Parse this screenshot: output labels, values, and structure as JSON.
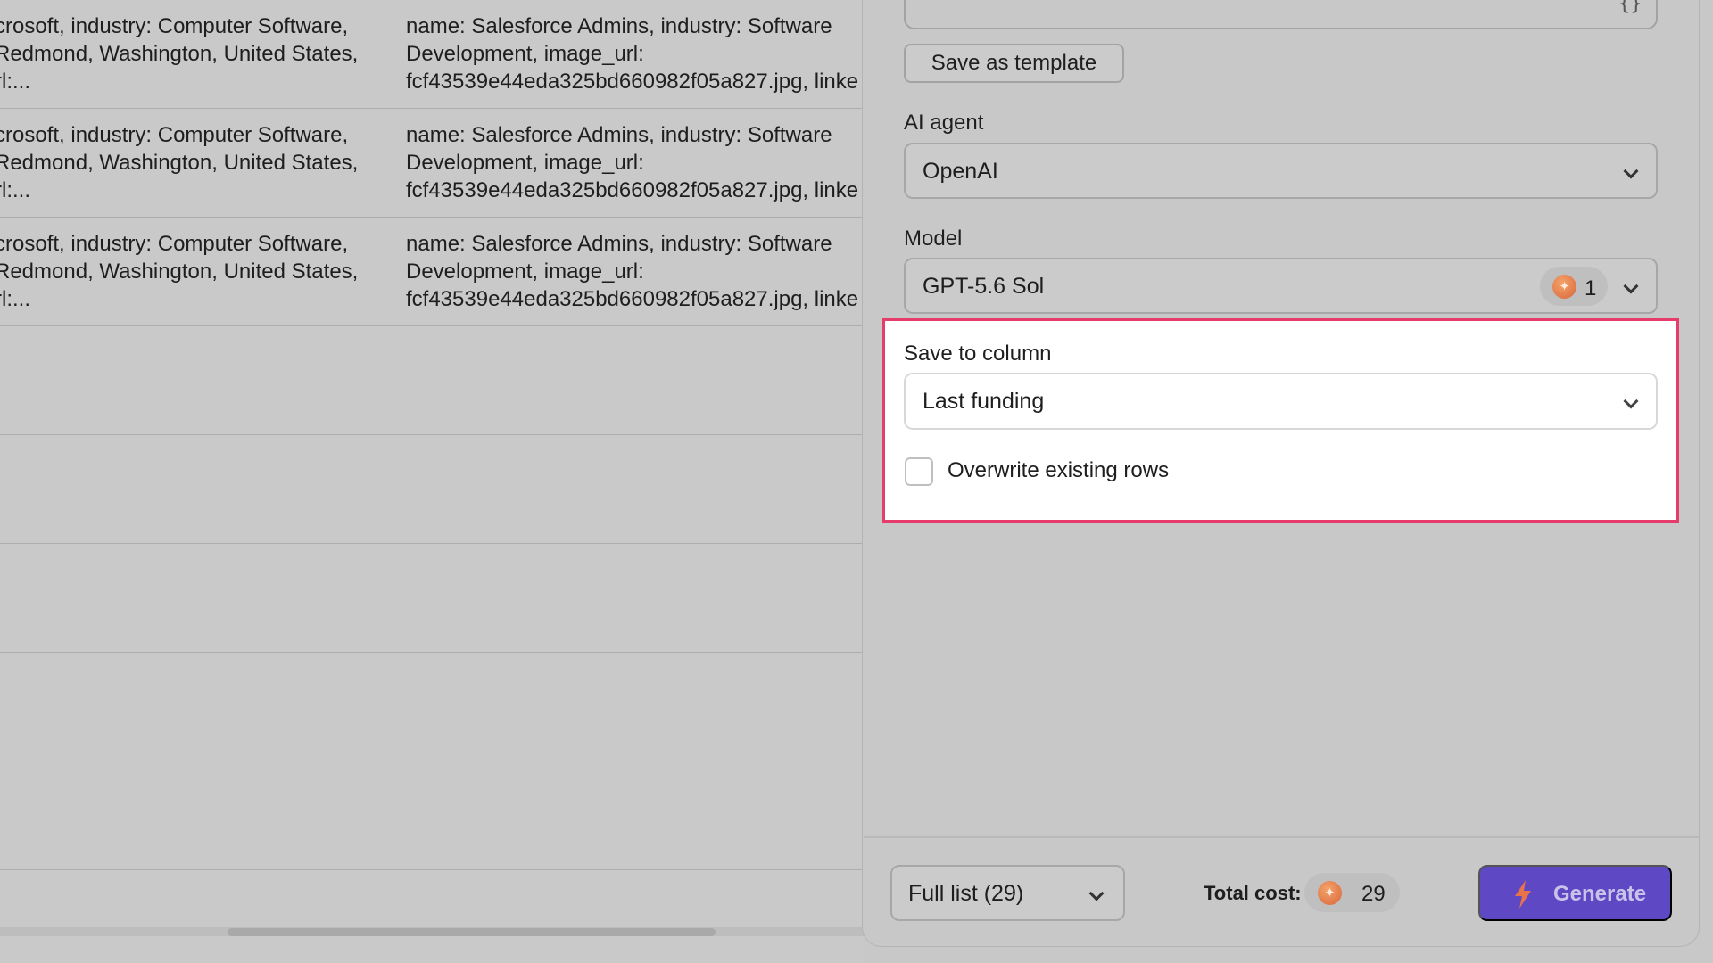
{
  "table": {
    "rows": [
      {
        "col_a": "crosoft, industry: Computer Software,\nRedmond, Washington, United States,\nrl:...",
        "col_b": "name: Salesforce Admins, industry: Software\nDevelopment, image_url:\nfcf43539e44eda325bd660982f05a827.jpg, linke"
      },
      {
        "col_a": "crosoft, industry: Computer Software,\nRedmond, Washington, United States,\nrl:...",
        "col_b": "name: Salesforce Admins, industry: Software\nDevelopment, image_url:\nfcf43539e44eda325bd660982f05a827.jpg, linke"
      },
      {
        "col_a": "crosoft, industry: Computer Software,\nRedmond, Washington, United States,\nrl:...",
        "col_b": "name: Salesforce Admins, industry: Software\nDevelopment, image_url:\nfcf43539e44eda325bd660982f05a827.jpg, linke"
      },
      {
        "col_a": "",
        "col_b": ""
      },
      {
        "col_a": "",
        "col_b": ""
      },
      {
        "col_a": "",
        "col_b": ""
      },
      {
        "col_a": "",
        "col_b": ""
      },
      {
        "col_a": "",
        "col_b": ""
      }
    ]
  },
  "panel": {
    "prompt_icon": "curly-braces-icon",
    "save_template_label": "Save as template",
    "ai_agent": {
      "label": "AI agent",
      "value": "OpenAI"
    },
    "model": {
      "label": "Model",
      "value": "GPT-5.6 Sol",
      "credit_cost": "1"
    },
    "save_to_column": {
      "label": "Save to column",
      "value": "Last funding",
      "highlight_color": "#e63c6c"
    },
    "overwrite": {
      "label": "Overwrite existing rows",
      "checked": false
    },
    "footer": {
      "list_value": "Full list (29)",
      "total_label": "Total cost:",
      "total_value": "29",
      "generate_label": "Generate",
      "generate_color": "#5f48c4"
    }
  }
}
